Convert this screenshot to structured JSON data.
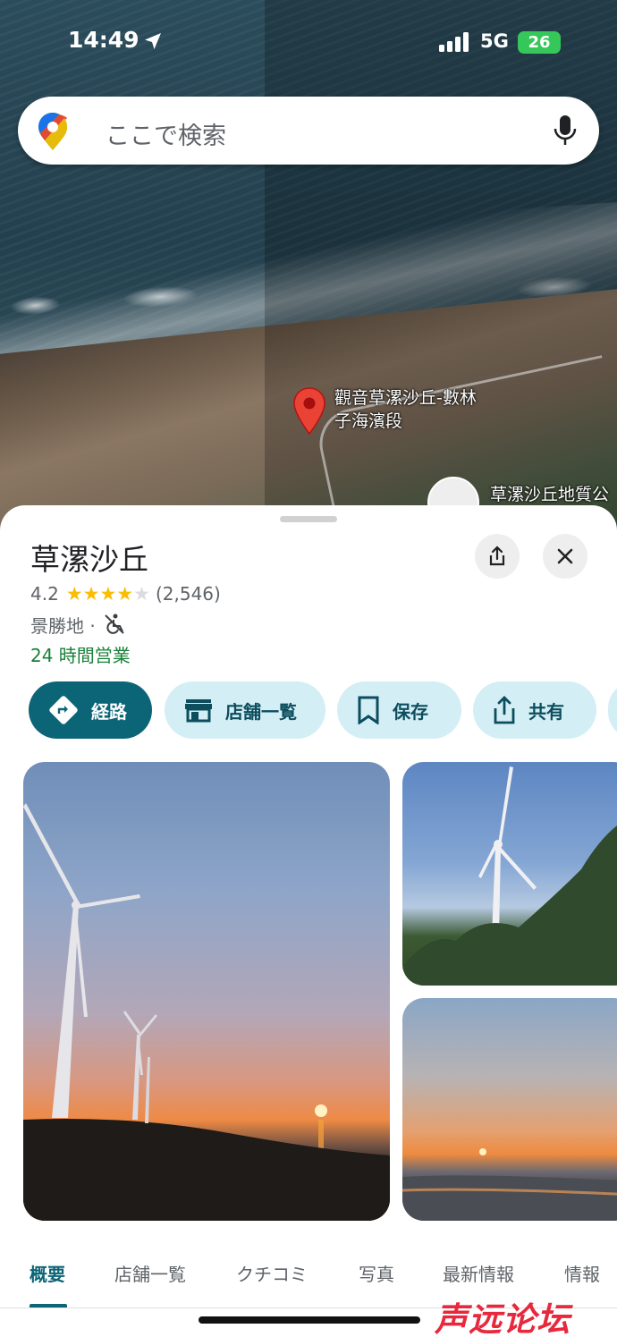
{
  "status_bar": {
    "time": "14:49",
    "network": "5G",
    "battery": "26"
  },
  "search": {
    "placeholder": "ここで検索"
  },
  "map": {
    "pin_label": "觀音草漯沙丘-數林子海濱段",
    "poi_label": "草漯沙丘地質公"
  },
  "place": {
    "title": "草漯沙丘",
    "rating": "4.2",
    "stars": 4.2,
    "review_count": "(2,546)",
    "category": "景勝地 ·",
    "hours": "24 時間営業"
  },
  "actions": {
    "directions": "経路",
    "store_list": "店舗一覧",
    "save": "保存",
    "share": "共有"
  },
  "tabs": [
    "概要",
    "店舗一覧",
    "クチコミ",
    "写真",
    "最新情報",
    "情報"
  ],
  "watermark": "声远论坛",
  "colors": {
    "accent": "#0b6577",
    "chip_bg": "#d3eef5",
    "open_green": "#188038",
    "star": "#fbbc04"
  }
}
